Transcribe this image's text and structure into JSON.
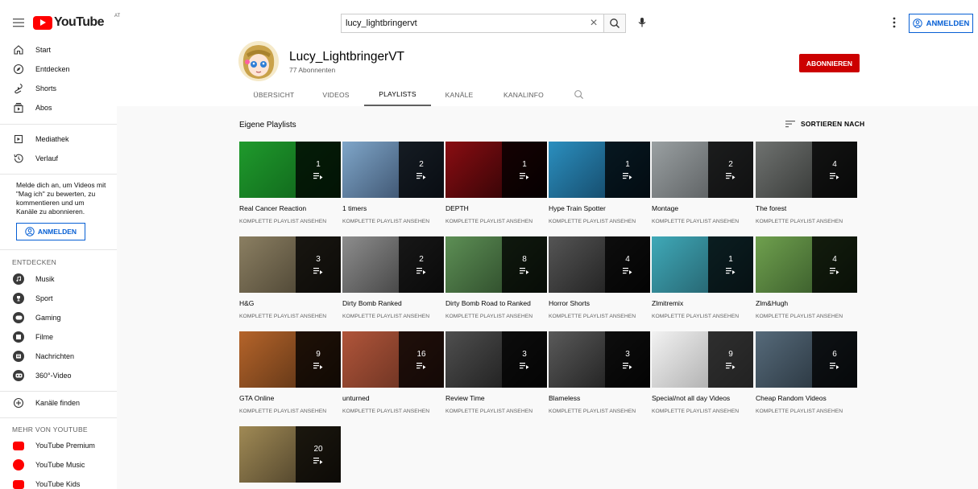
{
  "topbar": {
    "logo_text": "YouTube",
    "logo_region": "AT",
    "search_value": "lucy_lightbringervt",
    "signin_label": "ANMELDEN"
  },
  "sidebar": {
    "main_items": [
      {
        "label": "Start",
        "icon": "home-icon"
      },
      {
        "label": "Entdecken",
        "icon": "compass-icon"
      },
      {
        "label": "Shorts",
        "icon": "shorts-icon"
      },
      {
        "label": "Abos",
        "icon": "subscriptions-icon"
      }
    ],
    "library_items": [
      {
        "label": "Mediathek",
        "icon": "library-icon"
      },
      {
        "label": "Verlauf",
        "icon": "history-icon"
      }
    ],
    "signin_message": "Melde dich an, um Videos mit \"Mag ich\" zu bewerten, zu kommentieren und um Kanäle zu abonnieren.",
    "signin_label": "ANMELDEN",
    "explore_heading": "ENTDECKEN",
    "explore_items": [
      {
        "label": "Musik",
        "icon": "music-icon"
      },
      {
        "label": "Sport",
        "icon": "trophy-icon"
      },
      {
        "label": "Gaming",
        "icon": "gaming-icon"
      },
      {
        "label": "Filme",
        "icon": "film-icon"
      },
      {
        "label": "Nachrichten",
        "icon": "news-icon"
      },
      {
        "label": "360°-Video",
        "icon": "vr-icon"
      }
    ],
    "browse_channels": "Kanäle finden",
    "more_heading": "MEHR VON YOUTUBE",
    "more_items": [
      {
        "label": "YouTube Premium",
        "icon": "youtube-premium-icon"
      },
      {
        "label": "YouTube Music",
        "icon": "youtube-music-icon"
      },
      {
        "label": "YouTube Kids",
        "icon": "youtube-kids-icon"
      }
    ]
  },
  "channel": {
    "name": "Lucy_LightbringerVT",
    "subscribers": "77 Abonnenten",
    "subscribe_label": "ABONNIEREN",
    "tabs": [
      "ÜBERSICHT",
      "VIDEOS",
      "PLAYLISTS",
      "KANÄLE",
      "KANALINFO"
    ],
    "active_tab": "PLAYLISTS"
  },
  "content": {
    "section_title": "Eigene Playlists",
    "sort_label": "SORTIEREN NACH",
    "playlists": [
      {
        "title": "Real Cancer Reaction",
        "count": "1",
        "link": "KOMPLETTE PLAYLIST ANSEHEN",
        "colors": [
          "#1f9a2c",
          "#0d5a18"
        ]
      },
      {
        "title": "1 timers",
        "count": "2",
        "link": "KOMPLETTE PLAYLIST ANSEHEN",
        "colors": [
          "#7fa6c9",
          "#2a3b55"
        ]
      },
      {
        "title": "DEPTH",
        "count": "1",
        "link": "KOMPLETTE PLAYLIST ANSEHEN",
        "colors": [
          "#8a0d12",
          "#1a0203"
        ]
      },
      {
        "title": "Hype Train Spotter",
        "count": "1",
        "link": "KOMPLETTE PLAYLIST ANSEHEN",
        "colors": [
          "#2b8fbf",
          "#0f3550"
        ]
      },
      {
        "title": "Montage",
        "count": "2",
        "link": "KOMPLETTE PLAYLIST ANSEHEN",
        "colors": [
          "#9aa0a2",
          "#4a4d4f"
        ]
      },
      {
        "title": "The forest",
        "count": "4",
        "link": "KOMPLETTE PLAYLIST ANSEHEN",
        "colors": [
          "#6f7270",
          "#262826"
        ]
      },
      {
        "title": "H&G",
        "count": "3",
        "link": "KOMPLETTE PLAYLIST ANSEHEN",
        "colors": [
          "#8b7f62",
          "#3d3628"
        ]
      },
      {
        "title": "Dirty Bomb Ranked",
        "count": "2",
        "link": "KOMPLETTE PLAYLIST ANSEHEN",
        "colors": [
          "#8d8d8d",
          "#2e2e2e"
        ]
      },
      {
        "title": "Dirty Bomb Road to Ranked",
        "count": "8",
        "link": "KOMPLETTE PLAYLIST ANSEHEN",
        "colors": [
          "#5d8f55",
          "#223a20"
        ]
      },
      {
        "title": "Horror Shorts",
        "count": "4",
        "link": "KOMPLETTE PLAYLIST ANSEHEN",
        "colors": [
          "#555555",
          "#111111"
        ]
      },
      {
        "title": "Zlmitremix",
        "count": "1",
        "link": "KOMPLETTE PLAYLIST ANSEHEN",
        "colors": [
          "#3fa9b8",
          "#1f4f5a"
        ]
      },
      {
        "title": "Zlm&Hugh",
        "count": "4",
        "link": "KOMPLETTE PLAYLIST ANSEHEN",
        "colors": [
          "#6fa04e",
          "#2c4a22"
        ]
      },
      {
        "title": "GTA Online",
        "count": "9",
        "link": "KOMPLETTE PLAYLIST ANSEHEN",
        "colors": [
          "#b5642a",
          "#4a2a12"
        ]
      },
      {
        "title": "unturned",
        "count": "16",
        "link": "KOMPLETTE PLAYLIST ANSEHEN",
        "colors": [
          "#b0553a",
          "#5a2a1c"
        ]
      },
      {
        "title": "Review Time",
        "count": "3",
        "link": "KOMPLETTE PLAYLIST ANSEHEN",
        "colors": [
          "#4f4f4f",
          "#121212"
        ]
      },
      {
        "title": "Blameless",
        "count": "3",
        "link": "KOMPLETTE PLAYLIST ANSEHEN",
        "colors": [
          "#5a5a5a",
          "#101010"
        ]
      },
      {
        "title": "Special/not all day Videos",
        "count": "9",
        "link": "KOMPLETTE PLAYLIST ANSEHEN",
        "colors": [
          "#f2f2f2",
          "#9a9a9a"
        ]
      },
      {
        "title": "Cheap Random Videos",
        "count": "6",
        "link": "KOMPLETTE PLAYLIST ANSEHEN",
        "colors": [
          "#566a7a",
          "#1e2830"
        ]
      },
      {
        "title": "",
        "count": "20",
        "link": "",
        "colors": [
          "#a08a55",
          "#3a3020"
        ]
      }
    ]
  }
}
